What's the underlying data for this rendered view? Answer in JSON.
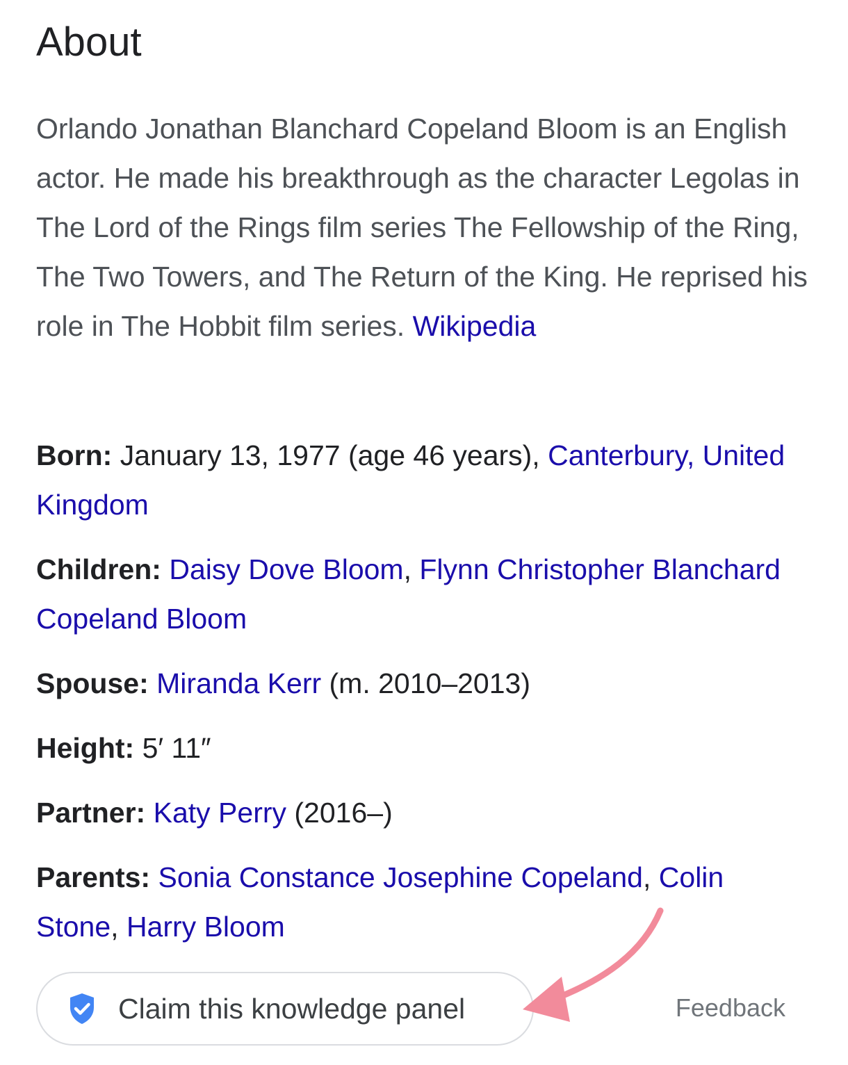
{
  "heading": "About",
  "description": {
    "text": "Orlando Jonathan Blanchard Copeland Bloom is an English actor. He made his breakthrough as the character Legolas in The Lord of the Rings film series The Fellowship of the Ring, The Two Towers, and The Return of the King. He reprised his role in The Hobbit film series. ",
    "source_link": "Wikipedia"
  },
  "facts": {
    "born": {
      "label": "Born:",
      "value": " January 13, 1977 (age 46 years), ",
      "link": "Canterbury, United Kingdom"
    },
    "children": {
      "label": "Children:",
      "link1": "Daisy Dove Bloom",
      "sep": ", ",
      "link2": "Flynn Christopher Blanchard Copeland Bloom"
    },
    "spouse": {
      "label": "Spouse:",
      "link": "Miranda Kerr",
      "suffix": " (m. 2010–2013)"
    },
    "height": {
      "label": "Height:",
      "value": " 5′ 11″"
    },
    "partner": {
      "label": "Partner:",
      "link": "Katy Perry",
      "suffix": " (2016–)"
    },
    "parents": {
      "label": "Parents:",
      "link1": "Sonia Constance Josephine Copeland",
      "sep1": ", ",
      "link2": "Colin Stone",
      "sep2": ", ",
      "link3": "Harry Bloom"
    }
  },
  "claim_button": {
    "label": "Claim this knowledge panel",
    "icon": "verified-shield-icon"
  },
  "feedback": "Feedback",
  "colors": {
    "link": "#1a0dab",
    "shield": "#4285f4",
    "annotation_arrow": "#f28b9b"
  }
}
